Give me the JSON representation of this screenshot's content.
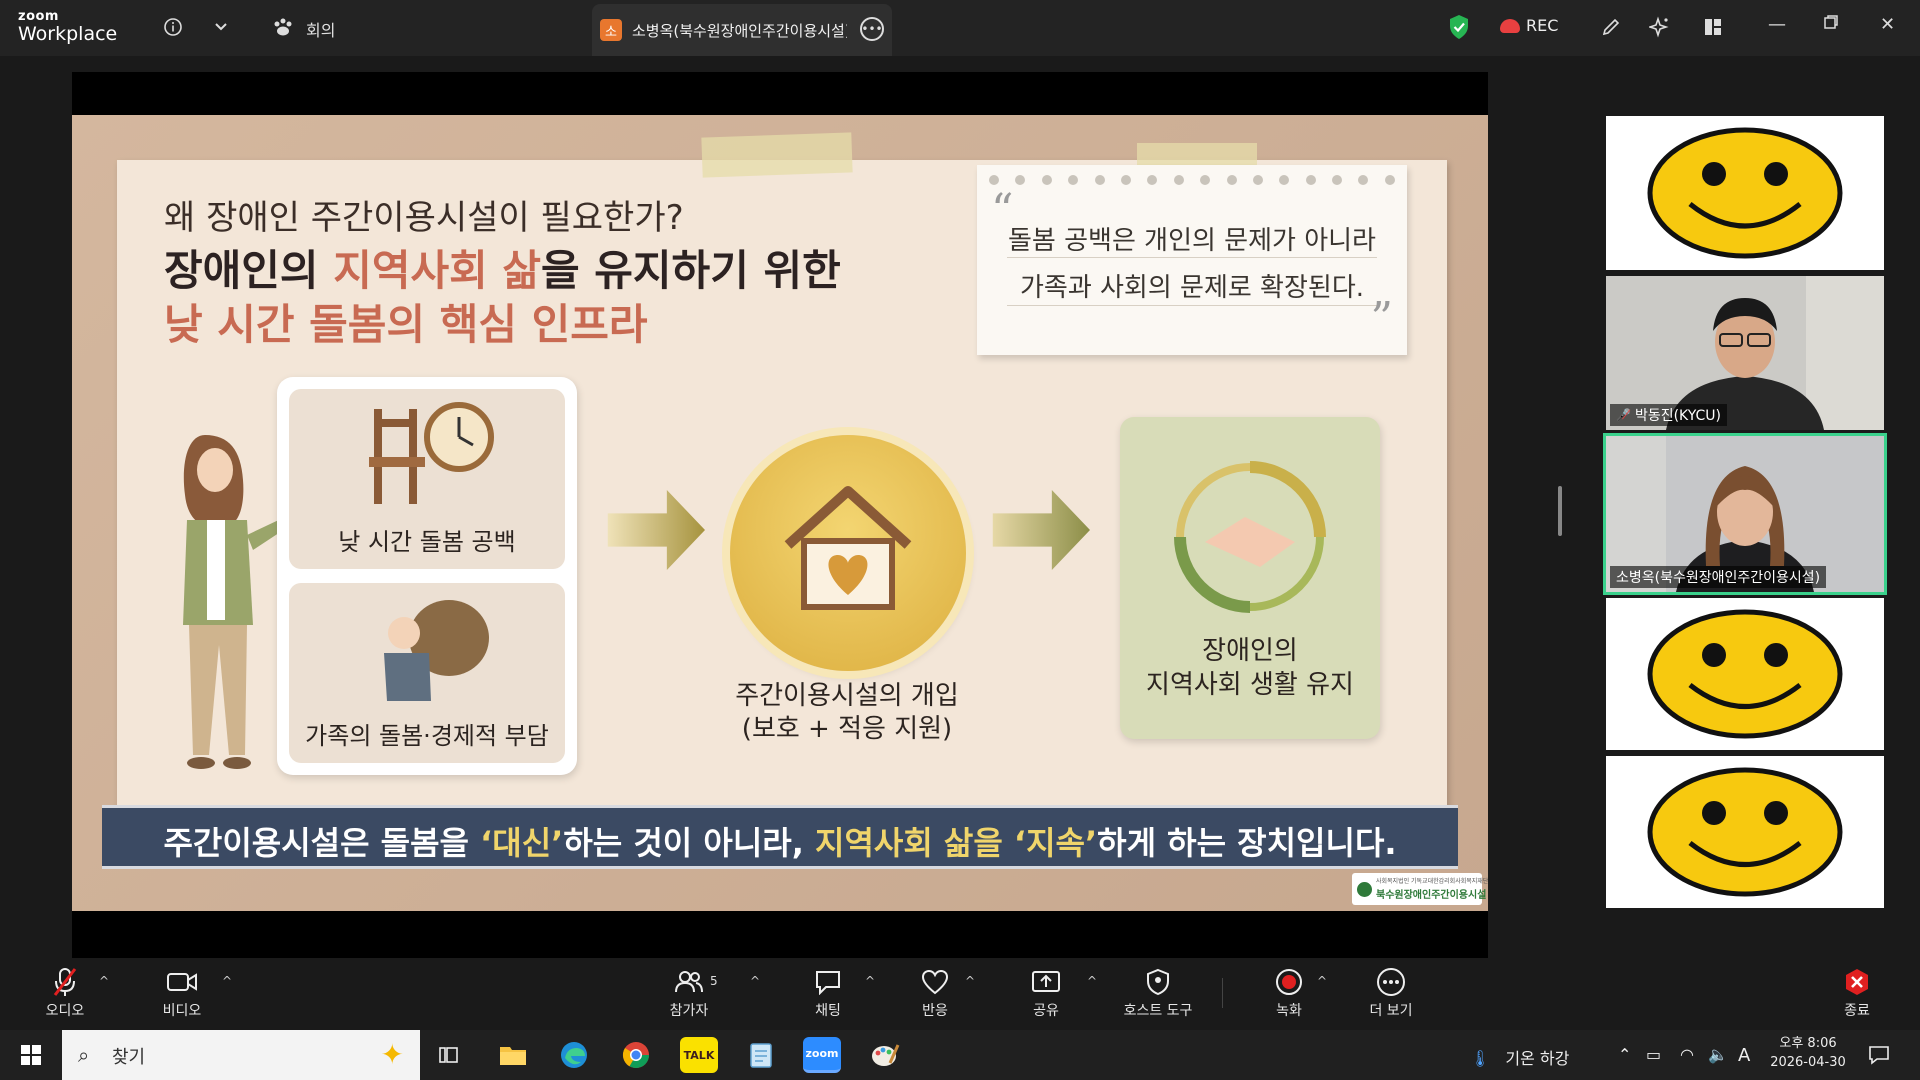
{
  "app": {
    "brand_small": "zoom",
    "brand_big": "Workplace",
    "meeting_label": "회의"
  },
  "tab": {
    "badge": "소",
    "title": "소병옥(북수원장애인주간이용시설)"
  },
  "titlebar": {
    "rec_label": "REC"
  },
  "slide": {
    "question": "왜 장애인 주간이용시설이 필요한가?",
    "headline_a": "장애인의 ",
    "headline_hl": "지역사회 삶",
    "headline_b": "을 유지하기 위한",
    "headline2": "낮 시간 돌봄의 핵심 인프라",
    "quote_open": "“",
    "quote_close": "”",
    "quote_line1": "돌봄 공백은 개인의 문제가 아니라",
    "quote_line2": "가족과 사회의 문제로 확장된다.",
    "card1_label": "낮 시간 돌봄 공백",
    "card2_label": "가족의 돌봄·경제적 부담",
    "center_line1": "주간이용시설의 개입",
    "center_line2": "(보호 + 적응 지원)",
    "right_line1": "장애인의",
    "right_line2": "지역사회 생활 유지",
    "banner_a": "주간이용시설은 돌봄을 ",
    "banner_y1": "‘대신’",
    "banner_b": "하는 것이 아니라, ",
    "banner_y2": "지역사회 삶을 ‘지속’",
    "banner_c": "하게 하는 장치입니다.",
    "footer_small": "사회복지법인 기독교대한감리회사회복지재단",
    "footer_name": "북수원장애인주간이용시설"
  },
  "participants": [
    {
      "name": "",
      "avatar": "smiley"
    },
    {
      "name": "박동진(KYCU)",
      "muted": true,
      "avatar": "photo"
    },
    {
      "name": "소병옥(북수원장애인주간이용시설)",
      "muted": false,
      "avatar": "photo",
      "active_speaker": true
    },
    {
      "name": "",
      "avatar": "smiley"
    },
    {
      "name": "",
      "avatar": "smiley"
    }
  ],
  "toolbar": {
    "audio": "오디오",
    "video": "비디오",
    "participants": "참가자",
    "participants_count": "5",
    "chat": "채팅",
    "reactions": "반응",
    "share": "공유",
    "host_tools": "호스트 도구",
    "record": "녹화",
    "more": "더 보기",
    "end": "종료"
  },
  "taskbar": {
    "search_placeholder": "찾기",
    "weather": "기온 하강",
    "ime": "A",
    "time": "오후 8:06",
    "date": "2026-04-30",
    "apps": [
      "task-view",
      "file-explorer",
      "edge",
      "chrome",
      "kakaotalk",
      "notepad",
      "zoom",
      "paint"
    ]
  },
  "colors": {
    "accent_speaker": "#3ad18c",
    "record_red": "#e02020",
    "end_red": "#e02020",
    "headline_accent": "#c86a52",
    "banner_bg": "#3b4a63"
  }
}
